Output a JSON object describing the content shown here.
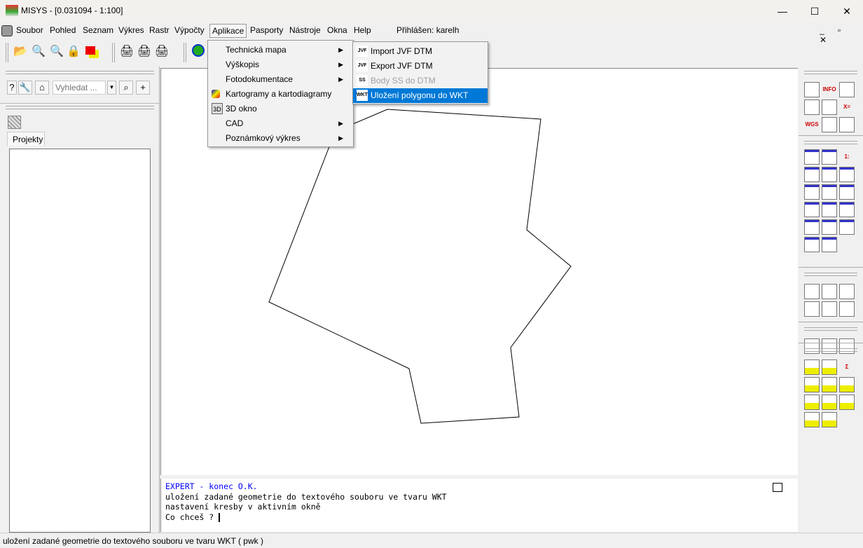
{
  "window": {
    "title": "MISYS - [0.031094 - 1:100]",
    "minimize": "—",
    "maximize": "☐",
    "close": "✕"
  },
  "menubar": {
    "items": [
      "Soubor",
      "Pohled",
      "Seznam",
      "Výkres",
      "Rastr",
      "Výpočty",
      "Aplikace",
      "Pasporty",
      "Nástroje",
      "Okna",
      "Help"
    ],
    "login": "Přihlášen: karelh",
    "active": "Aplikace"
  },
  "left_panel": {
    "search_placeholder": "Vyhledat ...",
    "tab": "Projekty",
    "help": "?"
  },
  "aplikace_menu": {
    "items": [
      {
        "label": "Technická mapa",
        "submenu": true
      },
      {
        "label": "Výškopis",
        "submenu": true
      },
      {
        "label": "Fotodokumentace",
        "submenu": true
      },
      {
        "label": "Kartogramy a kartodiagramy",
        "submenu": false
      },
      {
        "label": "3D okno",
        "submenu": false
      },
      {
        "label": "CAD",
        "submenu": true
      },
      {
        "label": "Poznámkový výkres",
        "submenu": true
      }
    ]
  },
  "submenu": {
    "items": [
      {
        "label": "Import JVF DTM",
        "icon": "JVF",
        "disabled": false,
        "selected": false
      },
      {
        "label": "Export JVF DTM",
        "icon": "JVF",
        "disabled": false,
        "selected": false
      },
      {
        "label": "Body SS do DTM",
        "icon": "SS",
        "disabled": true,
        "selected": false
      },
      {
        "label": "Uložení polygonu do WKT",
        "icon": "WKT",
        "disabled": false,
        "selected": true
      }
    ]
  },
  "command": {
    "lines": [
      "    EXPERT - konec O.K.",
      "uložení zadané geometrie do textového souboru ve tvaru WKT",
      "nastavení kresby v aktivním okně",
      "Co chceš ? "
    ]
  },
  "status": "uložení zadané geometrie do textového souboru ve tvaru WKT   ( pwk )",
  "colors": {
    "accent": "#0078d7",
    "expert": "#0000ff"
  }
}
